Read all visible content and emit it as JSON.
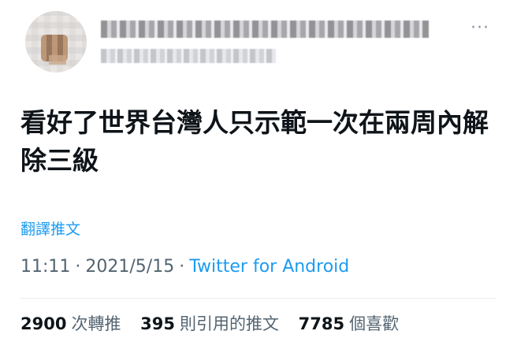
{
  "header": {
    "more_icon": "more-horizontal-icon",
    "more_glyph": "···"
  },
  "tweet": {
    "text": "看好了世界台灣人只示範一次在兩周內解除三級",
    "translate_label": "翻譯推文"
  },
  "meta": {
    "time": "11:11",
    "separator": "·",
    "date": "2021/5/15",
    "source": "Twitter for Android"
  },
  "stats": {
    "retweets_count": "2900",
    "retweets_label": "次轉推",
    "quotes_count": "395",
    "quotes_label": "則引用的推文",
    "likes_count": "7785",
    "likes_label": "個喜歡"
  },
  "colors": {
    "link": "#1d9bf0",
    "secondary_text": "#536471",
    "primary_text": "#0f1419"
  }
}
